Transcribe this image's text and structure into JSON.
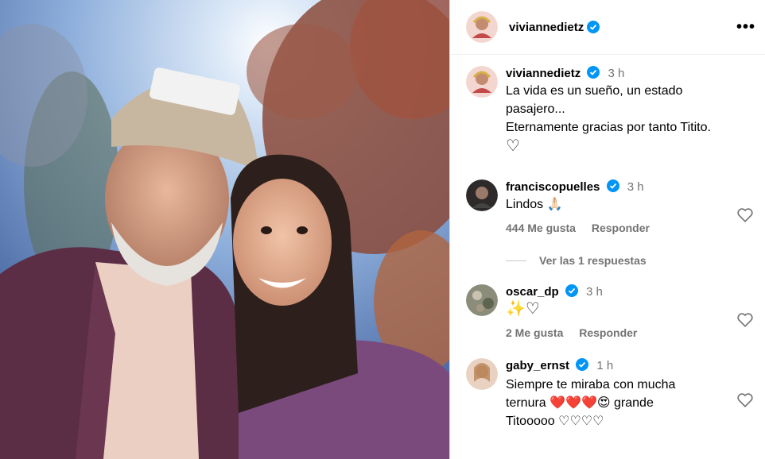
{
  "post": {
    "author": "viviannedietz",
    "caption_time": "3 h",
    "caption_lines": [
      "La vida es un sueño, un estado",
      "pasajero...",
      "Eternamente gracias por tanto Titito."
    ],
    "caption_tail": "♡"
  },
  "comments": [
    {
      "username": "franciscopuelles",
      "time": "3 h",
      "text": "Lindos 🙏🏻",
      "likes": "444 Me gusta",
      "reply": "Responder",
      "view_replies": "Ver las 1 respuestas"
    },
    {
      "username": "oscar_dp",
      "time": "3 h",
      "text": "✨♡",
      "likes": "2 Me gusta",
      "reply": "Responder"
    },
    {
      "username": "gaby_ernst",
      "time": "1 h",
      "text_lines": [
        "Siempre te miraba con mucha",
        "ternura ❤️❤️❤️😍 grande",
        "Titooooo ♡♡♡♡"
      ]
    }
  ],
  "colors": {
    "verified": "#0095f6",
    "muted": "#737373",
    "heart_red": "#e0245e"
  }
}
